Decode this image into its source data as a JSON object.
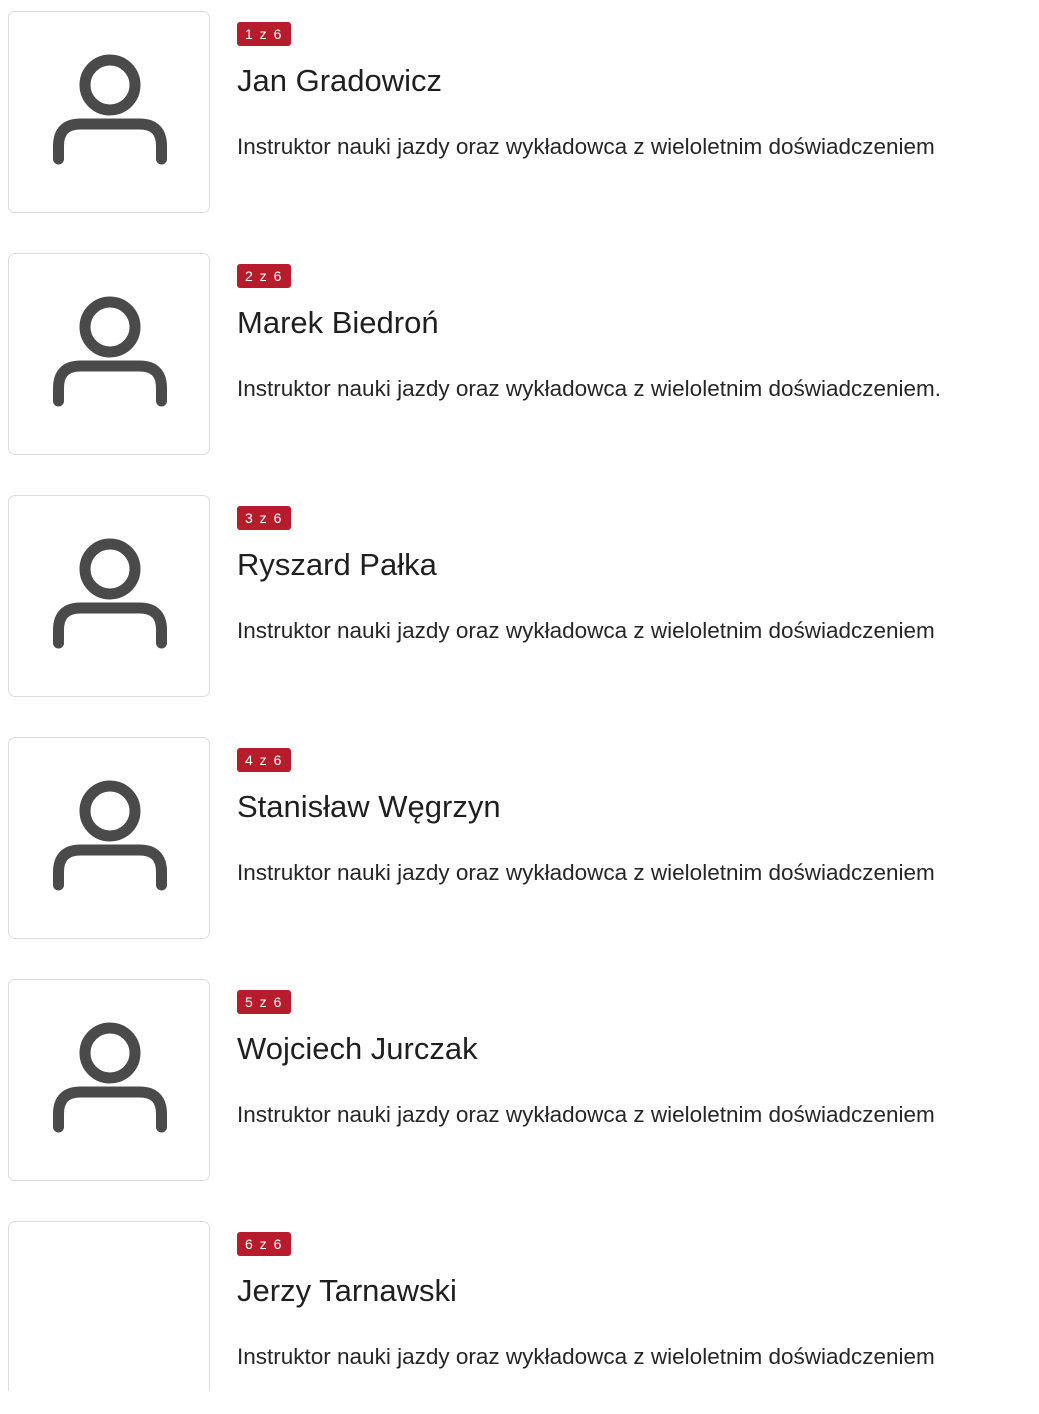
{
  "instructors": [
    {
      "counter": "1 z 6",
      "name": "Jan Gradowicz",
      "description": "Instruktor nauki jazdy oraz wykładowca z wieloletnim doświadczeniem",
      "avatar_icon": "user-icon"
    },
    {
      "counter": "2 z 6",
      "name": "Marek Biedroń",
      "description": "Instruktor nauki jazdy oraz wykładowca z wieloletnim doświadczeniem.",
      "avatar_icon": "user-icon"
    },
    {
      "counter": "3 z 6",
      "name": "Ryszard Pałka",
      "description": "Instruktor nauki jazdy oraz wykładowca z wieloletnim doświadczeniem",
      "avatar_icon": "user-icon"
    },
    {
      "counter": "4 z 6",
      "name": "Stanisław Węgrzyn",
      "description": "Instruktor nauki jazdy oraz wykładowca z wieloletnim doświadczeniem",
      "avatar_icon": "user-icon"
    },
    {
      "counter": "5 z 6",
      "name": "Wojciech Jurczak",
      "description": "Instruktor nauki jazdy oraz wykładowca z wieloletnim doświadczeniem",
      "avatar_icon": "user-icon"
    },
    {
      "counter": "6 z 6",
      "name": "Jerzy Tarnawski",
      "description": "Instruktor nauki jazdy oraz wykładowca z wieloletnim doświadczeniem",
      "avatar_icon": "none"
    }
  ],
  "colors": {
    "badge": "#b71c2c",
    "icon": "#4a4a4a"
  }
}
